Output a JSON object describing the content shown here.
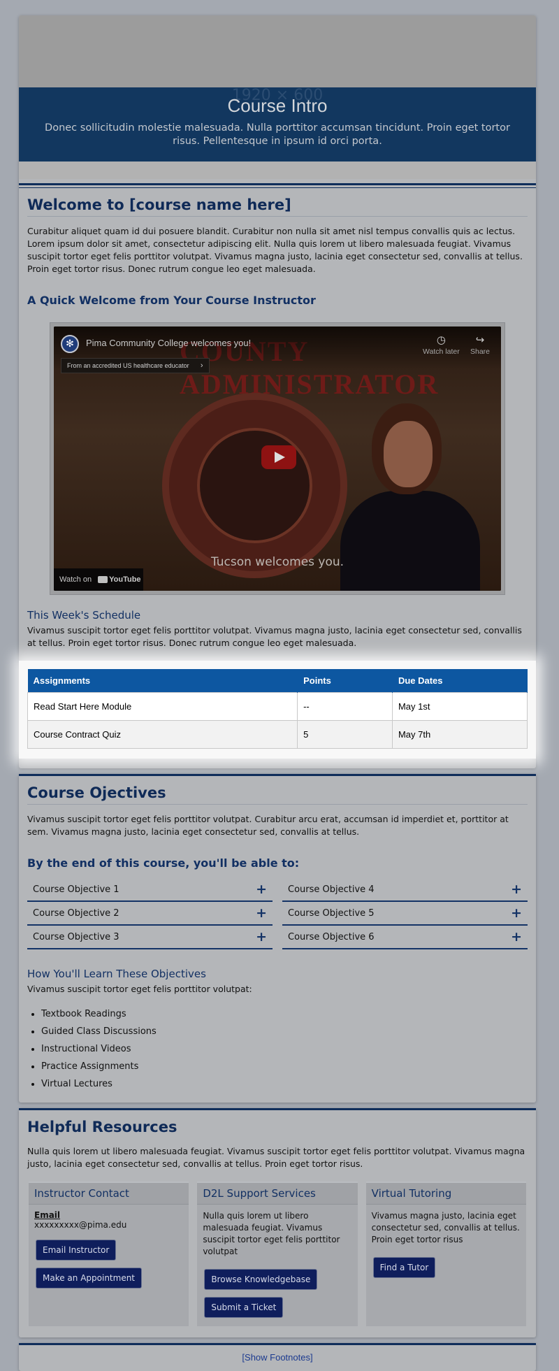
{
  "banner": {
    "ghost_text": "1920 × 600",
    "title": "Course Intro",
    "subtitle": "Donec sollicitudin molestie malesuada. Nulla porttitor accumsan tincidunt. Proin eget tortor risus. Pellentesque in ipsum id orci porta."
  },
  "welcome": {
    "title": "Welcome to [course name here]",
    "paragraph": "Curabitur aliquet quam id dui posuere blandit. Curabitur non nulla sit amet nisl tempus convallis quis ac lectus. Lorem ipsum dolor sit amet, consectetur adipiscing elit. Nulla quis lorem ut libero malesuada feugiat. Vivamus suscipit tortor eget felis porttitor volutpat. Vivamus magna justo, lacinia eget consectetur sed, convallis at tellus. Proin eget tortor risus. Donec rutrum congue leo eget malesuada.",
    "video_heading": "A Quick Welcome from Your Course Instructor"
  },
  "video": {
    "title": "Pima Community College welcomes you!",
    "chip": "From an accredited US healthcare educator",
    "watch_later": "Watch later",
    "share": "Share",
    "sign_text": "COUNTY ADMINISTRATOR",
    "caption": "Tucson welcomes you.",
    "watch_on": "Watch on",
    "platform": "YouTube"
  },
  "schedule": {
    "heading": "This Week's Schedule",
    "paragraph": "Vivamus suscipit tortor eget felis porttitor volutpat. Vivamus magna justo, lacinia eget consectetur sed, convallis at tellus. Proin eget tortor risus. Donec rutrum congue leo eget malesuada.",
    "columns": [
      "Assignments",
      "Points",
      "Due Dates"
    ],
    "rows": [
      [
        "Read Start Here Module",
        "--",
        "May 1st"
      ],
      [
        "Course Contract Quiz",
        "5",
        "May 7th"
      ]
    ]
  },
  "objectives": {
    "title": "Course Ojectives",
    "paragraph": "Vivamus suscipit tortor eget felis porttitor volutpat. Curabitur arcu erat, accumsan id imperdiet et, porttitor at sem. Vivamus magna justo, lacinia eget consectetur sed, convallis at tellus.",
    "able_heading": "By the end of this course, you'll be able to:",
    "items": [
      "Course Objective 1",
      "Course Objective 2",
      "Course Objective 3",
      "Course Objective 4",
      "Course Objective 5",
      "Course Objective 6"
    ],
    "expand_glyph": "+",
    "learn_heading": "How You'll Learn These Objectives",
    "learn_intro": "Vivamus suscipit tortor eget felis porttitor volutpat:",
    "learn_items": [
      "Textbook Readings",
      "Guided Class Discussions",
      "Instructional Videos",
      "Practice Assignments",
      "Virtual Lectures"
    ]
  },
  "resources": {
    "title": "Helpful Resources",
    "paragraph": "Nulla quis lorem ut libero malesuada feugiat. Vivamus suscipit tortor eget felis porttitor volutpat. Vivamus magna justo, lacinia eget consectetur sed, convallis at tellus. Proin eget tortor risus.",
    "instructor": {
      "title": "Instructor Contact",
      "email_label": "Email",
      "email": "xxxxxxxxx@pima.edu",
      "btn_email": "Email Instructor",
      "btn_appointment": "Make an Appointment"
    },
    "d2l": {
      "title": "D2L Support Services",
      "text": "Nulla quis lorem ut libero malesuada feugiat. Vivamus suscipit tortor eget felis porttitor volutpat",
      "btn_kb": "Browse Knowledgebase",
      "btn_ticket": "Submit a Ticket"
    },
    "tutoring": {
      "title": "Virtual Tutoring",
      "text": "Vivamus magna justo, lacinia eget consectetur sed, convallis at tellus. Proin eget tortor risus",
      "btn_tutor": "Find a Tutor"
    }
  },
  "footer": {
    "footnotes_link": "[Show Footnotes]"
  }
}
